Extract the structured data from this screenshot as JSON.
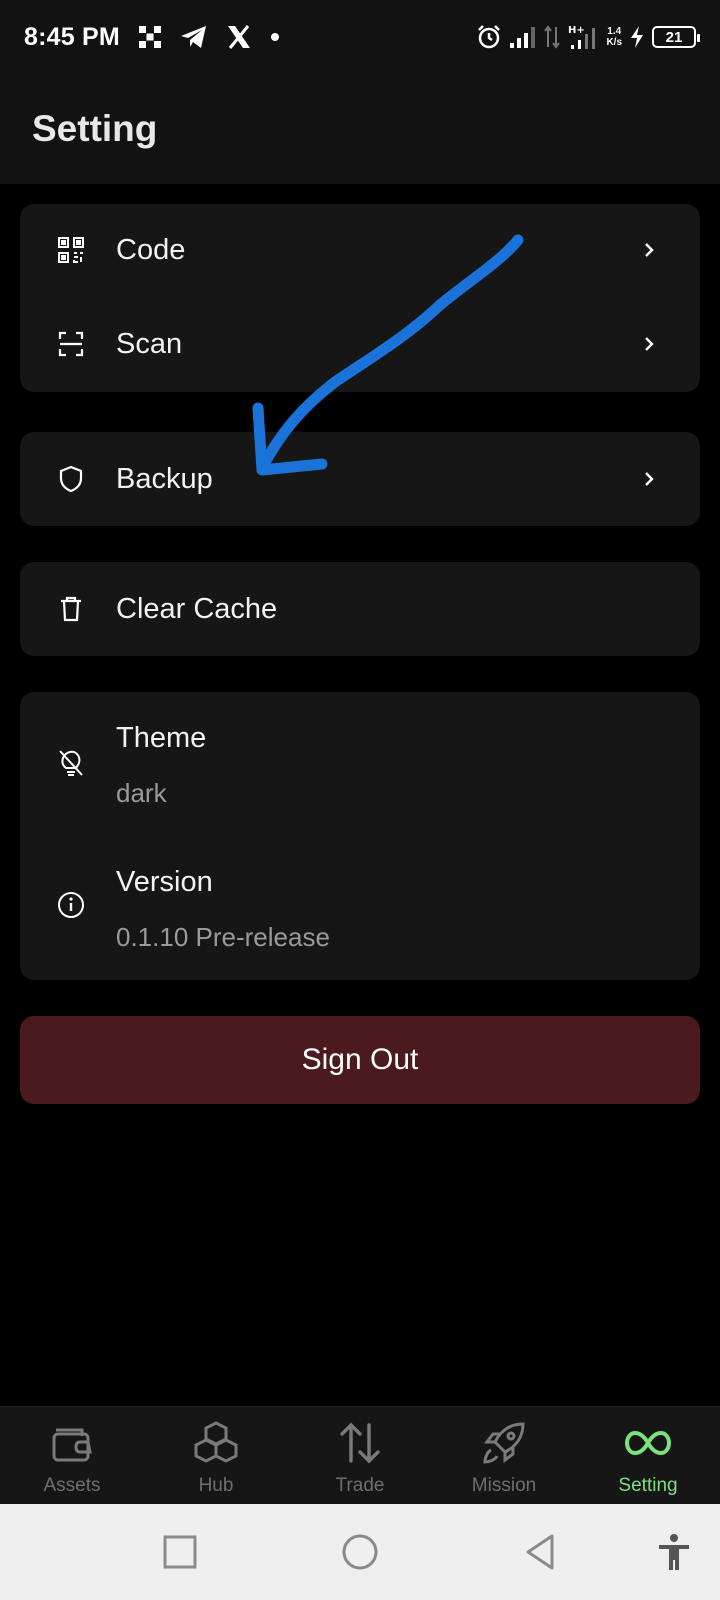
{
  "status": {
    "time": "8:45 PM",
    "network_speed_value": "1.4",
    "network_speed_unit": "K/s",
    "network_type": "H+",
    "battery_level": "21"
  },
  "header": {
    "title": "Setting"
  },
  "settings": {
    "code_label": "Code",
    "scan_label": "Scan",
    "backup_label": "Backup",
    "clear_cache_label": "Clear Cache",
    "theme_label": "Theme",
    "theme_value": "dark",
    "version_label": "Version",
    "version_value": "0.1.10 Pre-release"
  },
  "sign_out_label": "Sign Out",
  "bottom_nav": {
    "items": [
      {
        "label": "Assets",
        "icon": "wallet-icon"
      },
      {
        "label": "Hub",
        "icon": "cubes-icon"
      },
      {
        "label": "Trade",
        "icon": "arrows-up-down-icon"
      },
      {
        "label": "Mission",
        "icon": "rocket-icon"
      },
      {
        "label": "Setting",
        "icon": "infinity-icon"
      }
    ],
    "active": "Setting"
  },
  "colors": {
    "background": "#000000",
    "card": "#161616",
    "sign_out": "#4a1a1f",
    "active_nav": "#7be27b",
    "annotation_arrow": "#1a73d9"
  }
}
